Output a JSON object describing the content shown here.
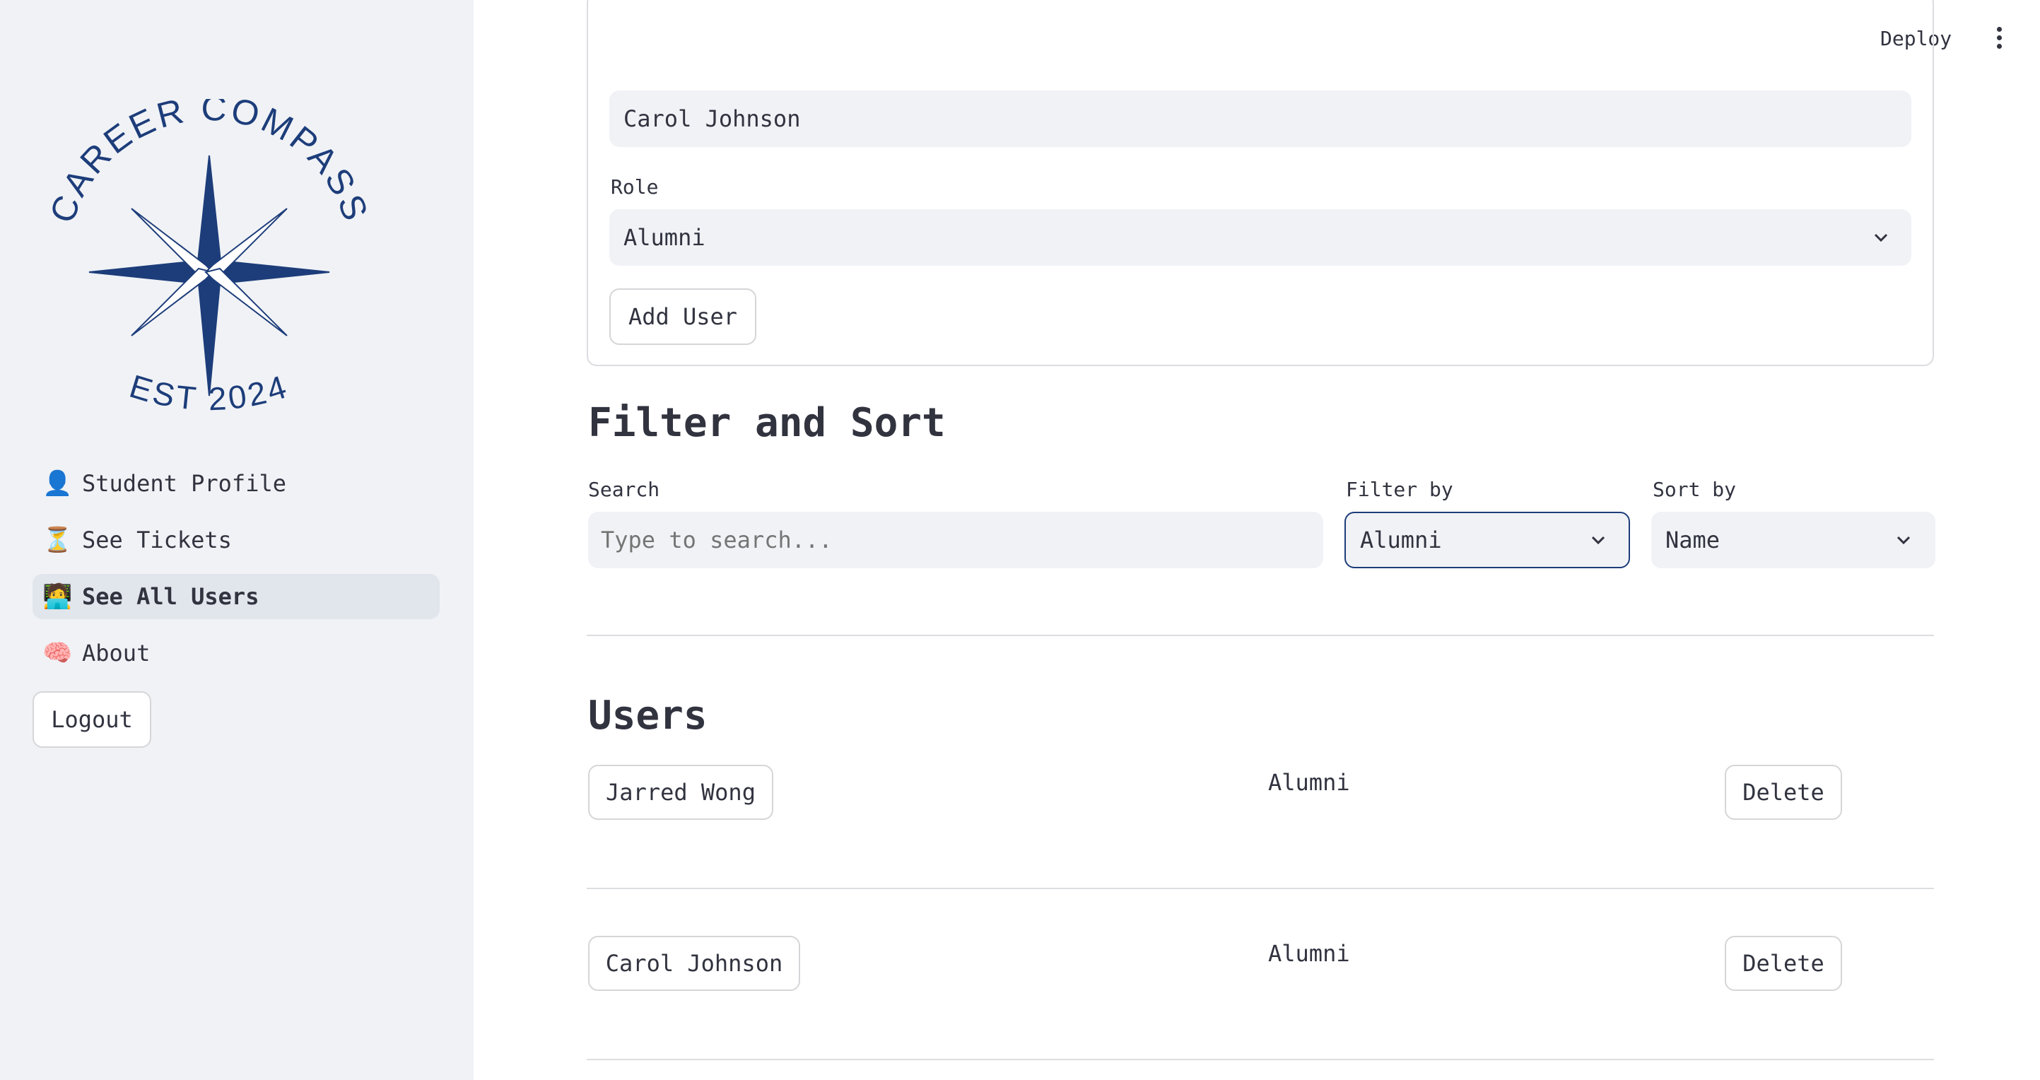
{
  "header": {
    "deploy_label": "Deploy"
  },
  "sidebar": {
    "logo": {
      "top_text": "CAREER COMPASS",
      "bottom_text": "EST 2024",
      "color": "#1d3d7a"
    },
    "items": [
      {
        "emoji": "👤",
        "label": "Student Profile",
        "active": false
      },
      {
        "emoji": "⏳",
        "label": "See Tickets",
        "active": false
      },
      {
        "emoji": "🧑‍💻",
        "label": "See All Users",
        "active": true
      },
      {
        "emoji": "🧠",
        "label": "About",
        "active": false
      }
    ],
    "logout_label": "Logout"
  },
  "add_user_form": {
    "name_value": "Carol Johnson",
    "role_label": "Role",
    "role_value": "Alumni",
    "add_button_label": "Add User"
  },
  "filter_sort": {
    "heading": "Filter and Sort",
    "search_label": "Search",
    "search_placeholder": "Type to search...",
    "filter_label": "Filter by",
    "filter_value": "Alumni",
    "sort_label": "Sort by",
    "sort_value": "Name"
  },
  "users": {
    "heading": "Users",
    "rows": [
      {
        "name": "Jarred Wong",
        "role": "Alumni",
        "delete_label": "Delete"
      },
      {
        "name": "Carol Johnson",
        "role": "Alumni",
        "delete_label": "Delete"
      }
    ]
  },
  "colors": {
    "accent_focus": "#1d3d7a",
    "sidebar_bg": "#f0f2f6",
    "input_bg": "#f0f2f6"
  }
}
